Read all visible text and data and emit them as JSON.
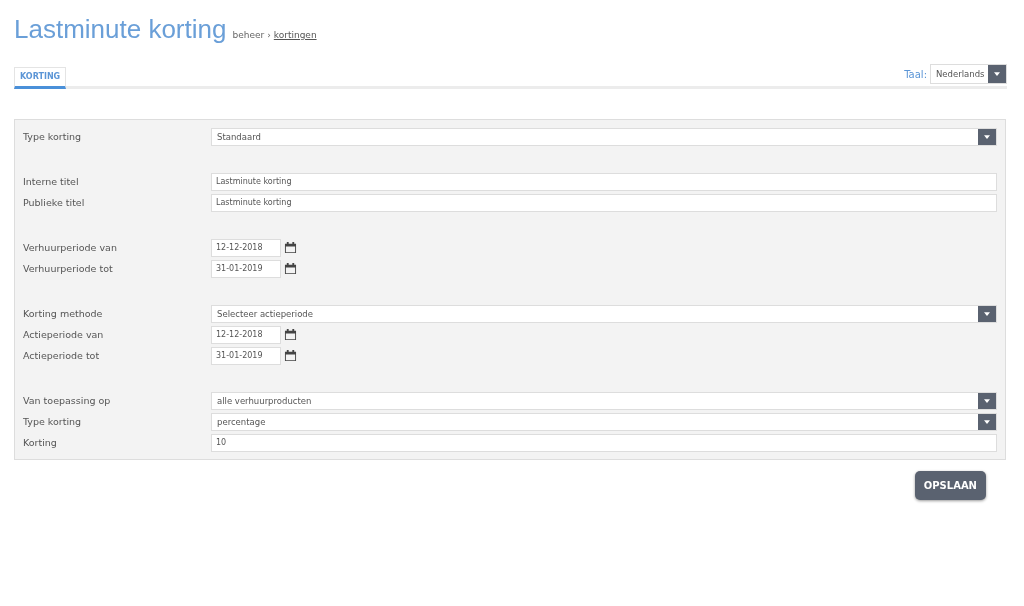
{
  "header": {
    "title": "Lastminute korting",
    "breadcrumb": {
      "parent": "beheer",
      "separator": "›",
      "current": "kortingen"
    }
  },
  "tabs": [
    {
      "label": "KORTING",
      "selected": true
    }
  ],
  "language": {
    "label": "Taal:",
    "value": "Nederlands"
  },
  "form": {
    "groups": [
      [
        {
          "label": "Type korting",
          "kind": "select",
          "value": "Standaard"
        }
      ],
      [
        {
          "label": "Interne titel",
          "kind": "text",
          "value": "Lastminute korting"
        },
        {
          "label": "Publieke titel",
          "kind": "text",
          "value": "Lastminute korting"
        }
      ],
      [
        {
          "label": "Verhuurperiode van",
          "kind": "date",
          "value": "12-12-2018"
        },
        {
          "label": "Verhuurperiode tot",
          "kind": "date",
          "value": "31-01-2019"
        }
      ],
      [
        {
          "label": "Korting methode",
          "kind": "select",
          "value": "Selecteer actieperiode"
        },
        {
          "label": "Actieperiode van",
          "kind": "date",
          "value": "12-12-2018"
        },
        {
          "label": "Actieperiode tot",
          "kind": "date",
          "value": "31-01-2019"
        }
      ],
      [
        {
          "label": "Van toepassing op",
          "kind": "select",
          "value": "alle verhuurproducten"
        },
        {
          "label": "Type korting",
          "kind": "select",
          "value": "percentage"
        },
        {
          "label": "Korting",
          "kind": "text",
          "value": "10"
        }
      ]
    ]
  },
  "save_button": "OPSLAAN"
}
